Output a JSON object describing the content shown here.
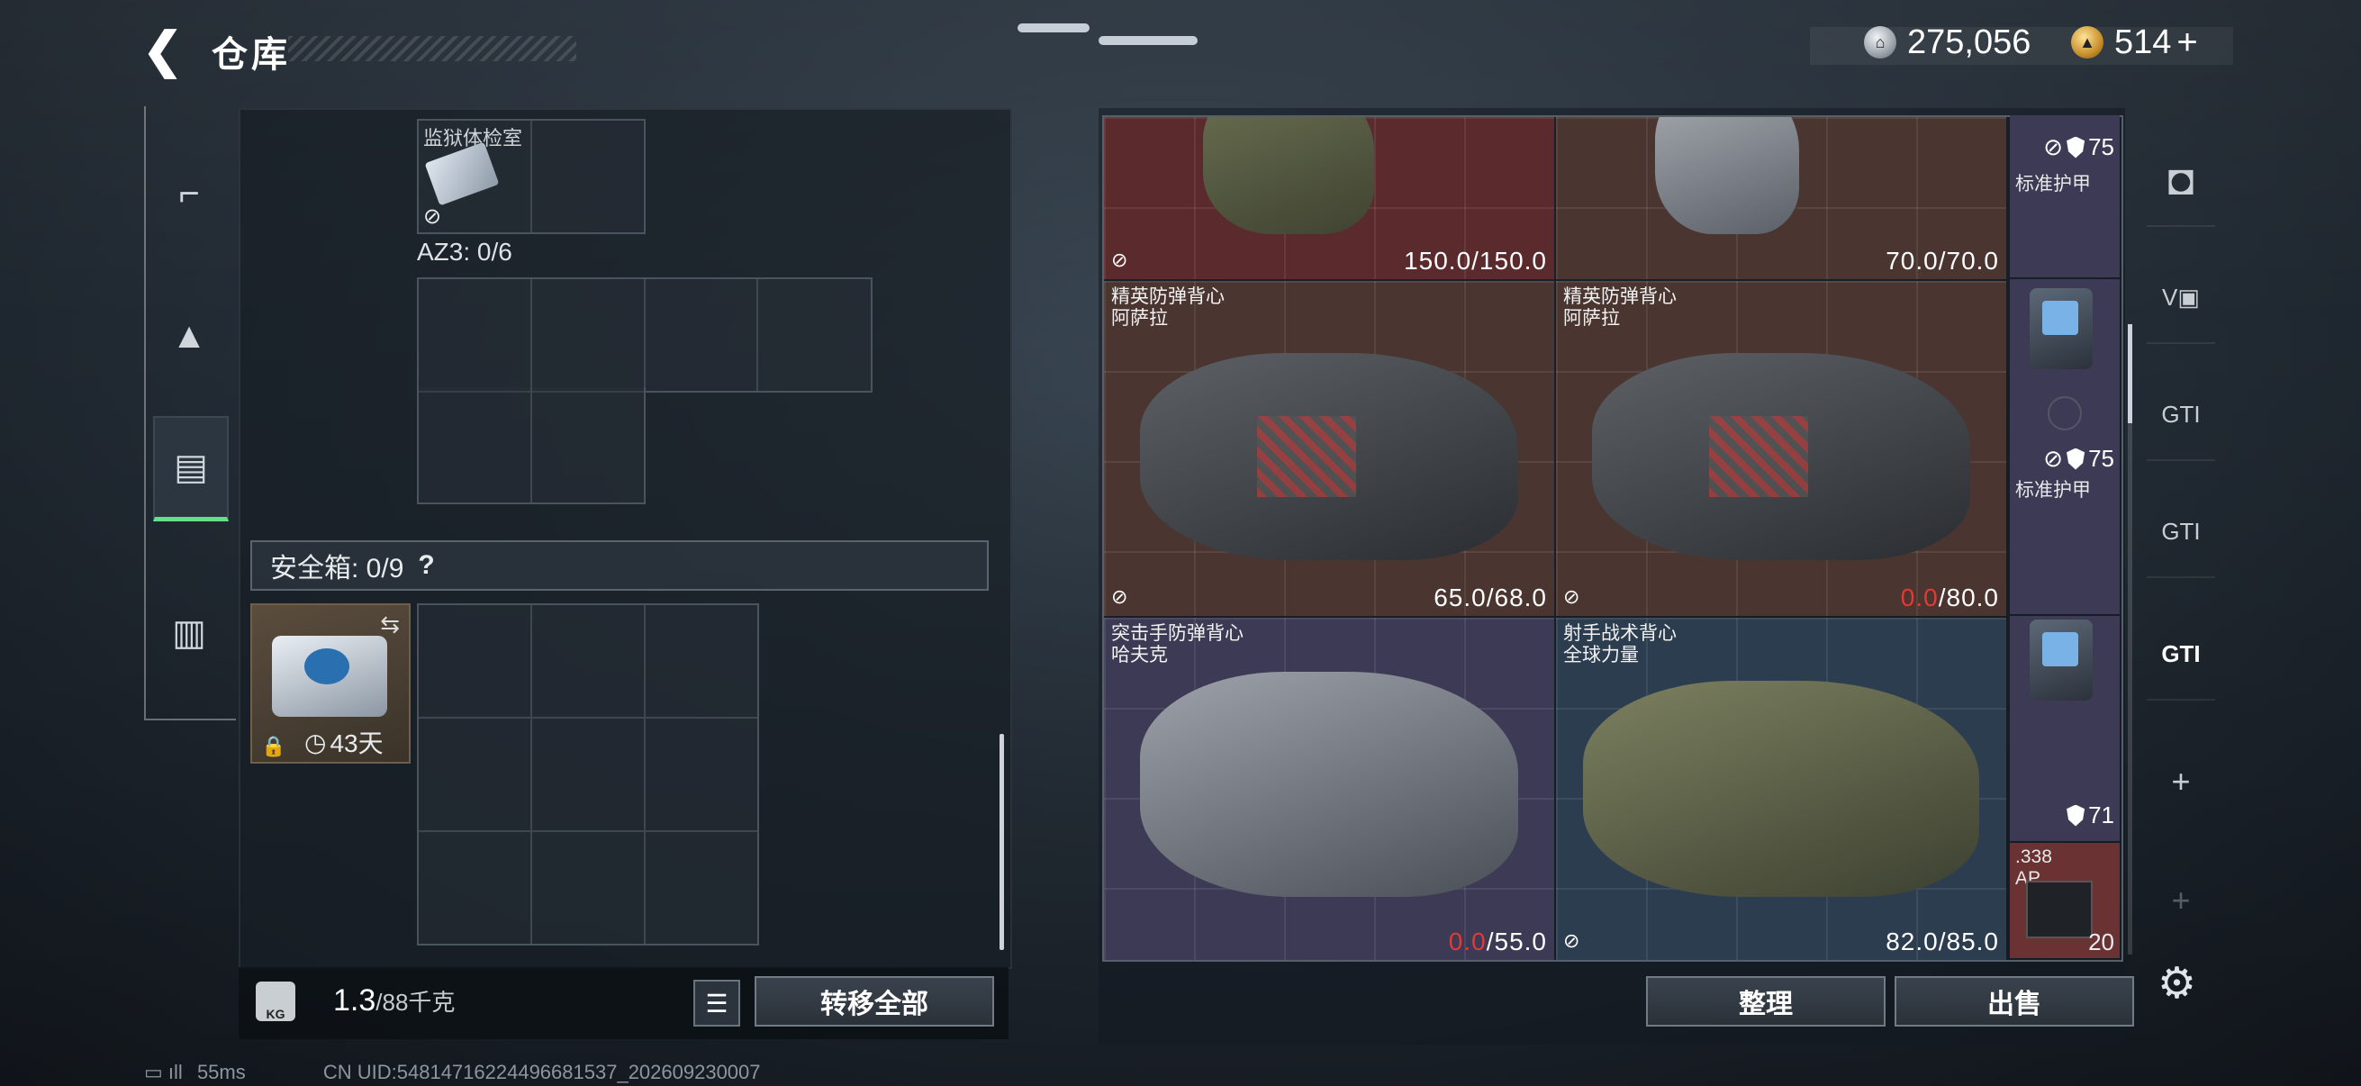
{
  "header": {
    "back_icon": "back-arrow-icon",
    "title": "仓库",
    "currency_silver": "275,056",
    "currency_gold": "514",
    "gold_plus": "+"
  },
  "left_tabs": [
    {
      "icon": "gun-icon",
      "glyph": "⌐"
    },
    {
      "icon": "backpack-icon",
      "glyph": "▲"
    },
    {
      "icon": "clipboard-icon",
      "glyph": "▤"
    },
    {
      "icon": "toolbox-icon",
      "glyph": "▥"
    }
  ],
  "storage": {
    "top_item_label": "监狱体检室",
    "az3_label": "AZ3: 0/6",
    "safe_box_label": "安全箱: 0/9",
    "safe_help": "?",
    "safe_item_days": "43天"
  },
  "footer_left": {
    "weight_value": "1.3",
    "weight_capacity": "/88千克",
    "kg_label": "KG",
    "transfer_all": "转移全部"
  },
  "items": [
    {
      "name1": "",
      "name2": "",
      "durability": "150.0/150.0",
      "dura_red": "",
      "dura_rest": ""
    },
    {
      "name1": "",
      "name2": "",
      "durability": "70.0/70.0",
      "dura_red": "",
      "dura_rest": ""
    },
    {
      "name1": "精英防弹背心",
      "name2": "阿萨拉",
      "durability": "65.0/68.0",
      "dura_red": "",
      "dura_rest": ""
    },
    {
      "name1": "精英防弹背心",
      "name2": "阿萨拉",
      "durability": "",
      "dura_red": "0.0",
      "dura_rest": "/80.0"
    },
    {
      "name1": "突击手防弹背心",
      "name2": "哈夫克",
      "durability": "",
      "dura_red": "0.0",
      "dura_rest": "/55.0"
    },
    {
      "name1": "射手战术背心",
      "name2": "全球力量",
      "durability": "82.0/85.0",
      "dura_red": "",
      "dura_rest": ""
    }
  ],
  "side_items": [
    {
      "armor": "75",
      "label": "标准护甲"
    },
    {
      "armor": "75",
      "label": "标准护甲"
    },
    {
      "armor": "71",
      "label": ""
    },
    {
      "ammo_label": ".338 AP",
      "count": "20"
    }
  ],
  "footer_right": {
    "organize": "整理",
    "sell": "出售"
  },
  "right_bar": [
    {
      "icon": "helmet-icon",
      "text": "◘"
    },
    {
      "icon": "gun-attachment-icon",
      "text": "V▣"
    },
    {
      "icon": "gti-rifle-icon",
      "text": "GTI"
    },
    {
      "icon": "gti-pistol-icon",
      "text": "GTI"
    },
    {
      "icon": "gti-stack-icon",
      "text": "GTI"
    },
    {
      "icon": "add-icon",
      "text": "+"
    },
    {
      "icon": "add-icon-disabled",
      "text": "+"
    }
  ],
  "status_bar": {
    "ping": "55ms",
    "uid": "CN UID:5481471622449668153​7_202609230007"
  },
  "colors": {
    "accent_green": "#62e08a",
    "red_durability": "#e03a36",
    "cell_red": "#5a2a2c",
    "cell_brown": "#4a3530",
    "cell_purple": "#3d3a55",
    "cell_blue": "#2c3d4f"
  }
}
